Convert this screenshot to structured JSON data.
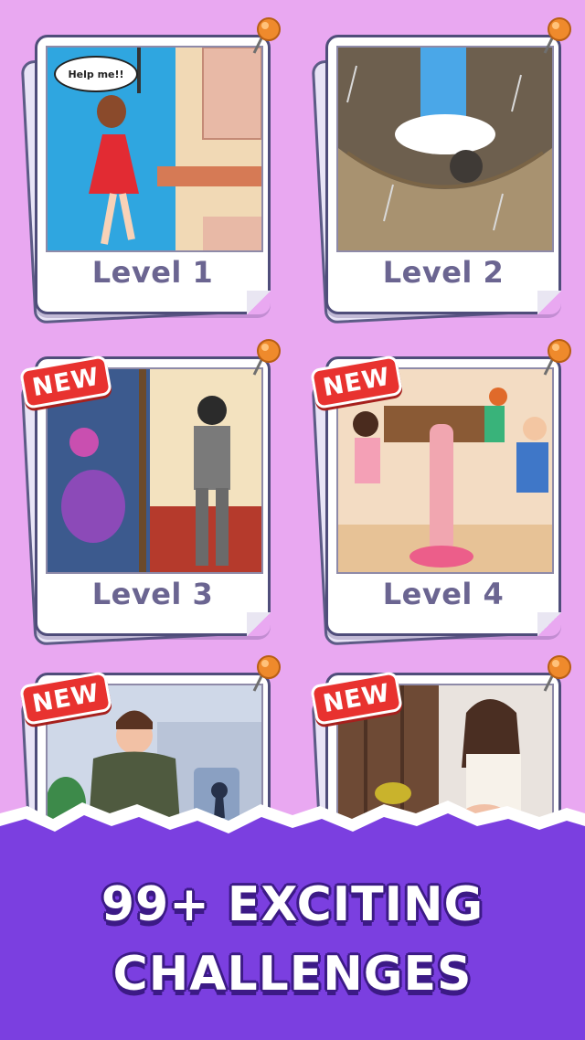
{
  "levels": [
    {
      "label": "Level 1",
      "is_new": false
    },
    {
      "label": "Level 2",
      "is_new": false
    },
    {
      "label": "Level 3",
      "is_new": true
    },
    {
      "label": "Level 4",
      "is_new": true
    },
    {
      "label": "",
      "is_new": true
    },
    {
      "label": "",
      "is_new": true
    }
  ],
  "speech_bubble": "Help me!!",
  "new_badge": "NEW",
  "banner": {
    "line1": "99+ EXCITING",
    "line2": "CHALLENGES"
  },
  "colors": {
    "background": "#e9a8f1",
    "banner": "#7b3fe0",
    "badge": "#e8322f",
    "label": "#6b6591"
  }
}
